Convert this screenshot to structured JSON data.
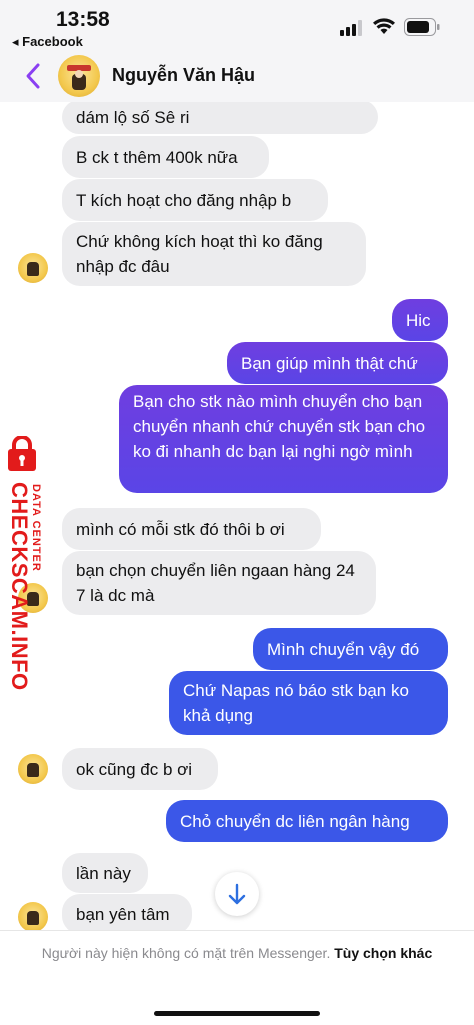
{
  "status_bar": {
    "time": "13:58",
    "back_app": "◂ Facebook"
  },
  "header": {
    "contact_name": "Nguyễn Văn Hậu"
  },
  "colors": {
    "outgoing_top": "#7b3fd6",
    "outgoing_bottom": "#3b57e8",
    "incoming": "#ececee",
    "accent": "#8a3ff2",
    "watermark": "#e21b1b"
  },
  "messages": [
    {
      "dir": "in",
      "text": "dám lộ số Sê ri"
    },
    {
      "dir": "in",
      "text": "B ck t thêm 400k nữa"
    },
    {
      "dir": "in",
      "text": "T kích hoạt cho đăng nhập b"
    },
    {
      "dir": "in",
      "text": "Chứ không kích hoạt thì ko đăng nhập đc đâu"
    },
    {
      "dir": "out",
      "text": "Hic"
    },
    {
      "dir": "out",
      "text": "Bạn giúp mình thật chứ"
    },
    {
      "dir": "out",
      "text": "Bạn cho stk nào mình chuyển cho bạn chuyển nhanh chứ chuyển stk bạn cho ko đi nhanh dc bạn lại nghi ngờ mình"
    },
    {
      "dir": "in",
      "text": "mình có mỗi stk đó thôi b ơi"
    },
    {
      "dir": "in",
      "text": "bạn chọn chuyển liên ngaan hàng 24 7 là dc mà"
    },
    {
      "dir": "out",
      "text": "Mình chuyển vậy đó"
    },
    {
      "dir": "out",
      "text": "Chứ Napas nó báo stk bạn ko khả dụng"
    },
    {
      "dir": "in",
      "text": "ok cũng đc b ơi"
    },
    {
      "dir": "out",
      "text": "Chỏ chuyển dc liên ngân hàng"
    },
    {
      "dir": "in",
      "text": "lần này"
    },
    {
      "dir": "in",
      "text": "bạn yên tâm"
    }
  ],
  "watermark": {
    "brand": "CHECKSCAM.INFO",
    "tagline": "DATA CENTER"
  },
  "footer": {
    "notice": "Người này hiện không có mặt trên Messenger.",
    "action": "Tùy chọn khác"
  },
  "icons": {
    "back": "chevron-left-icon",
    "scroll": "arrow-down-icon",
    "signal": "cellular-signal-icon",
    "wifi": "wifi-icon",
    "battery": "battery-icon"
  }
}
